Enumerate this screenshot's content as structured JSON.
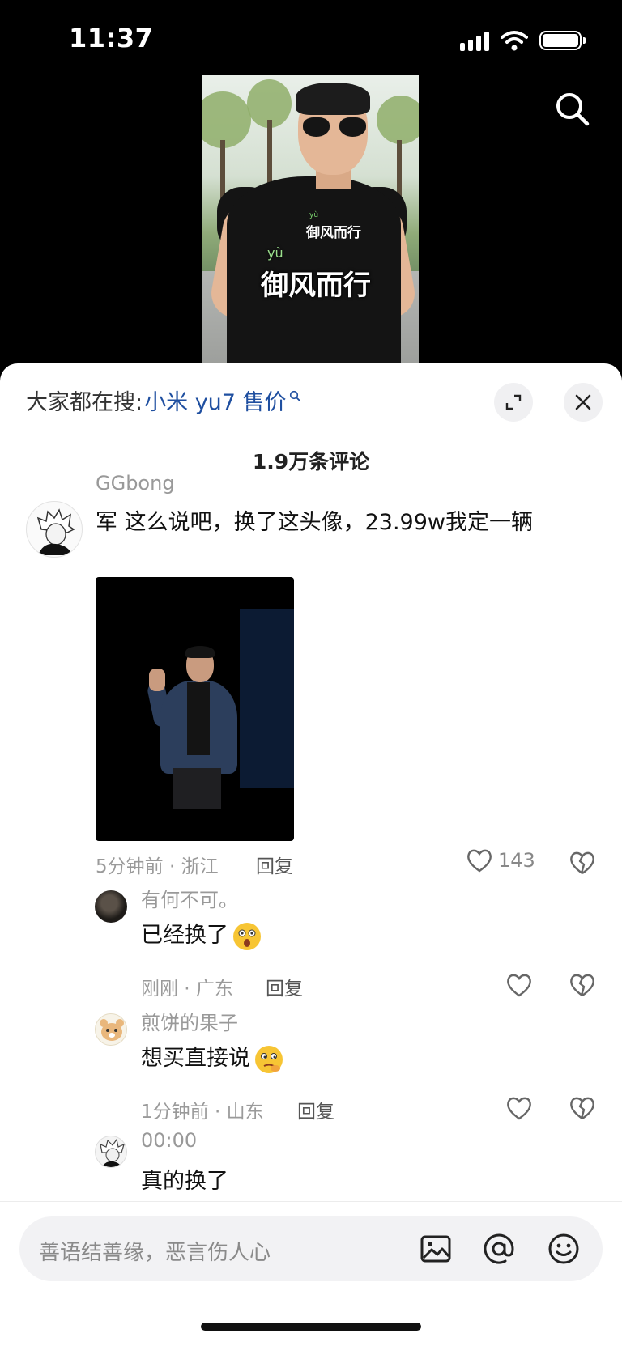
{
  "status_bar": {
    "time": "11:37"
  },
  "video": {
    "shirt_text": "御风而行",
    "shirt_pinyin": "yù",
    "caption": "御风而行",
    "caption_pinyin": "yù"
  },
  "comments_panel": {
    "hot_search_prefix": "大家都在搜:",
    "hot_search_keyword": "小米 yu7 售价",
    "comment_count": "1.9万条评论"
  },
  "main_comment": {
    "username": "GGbong",
    "text": "军 这么说吧，换了这头像，23.99w我定一辆",
    "time_location": "5分钟前 · 浙江",
    "reply_label": "回复",
    "likes": "143"
  },
  "replies": [
    {
      "username": "有何不可。",
      "text": "已经换了",
      "time_location": "刚刚 · 广东",
      "reply_label": "回复"
    },
    {
      "username": "煎饼的果子",
      "text": "想买直接说",
      "time_location": "1分钟前 · 山东",
      "reply_label": "回复"
    },
    {
      "username": "00:00",
      "text": "真的换了"
    }
  ],
  "input": {
    "placeholder": "善语结善缘，恶言伤人心"
  },
  "colors": {
    "keyword_link": "#1f4fa0",
    "sheet_bg": "#ffffff",
    "muted_text": "#999999"
  },
  "icons": [
    "search-icon",
    "expand-icon",
    "close-icon",
    "heart-icon",
    "broken-heart-icon",
    "image-icon",
    "at-icon",
    "emoji-icon"
  ]
}
